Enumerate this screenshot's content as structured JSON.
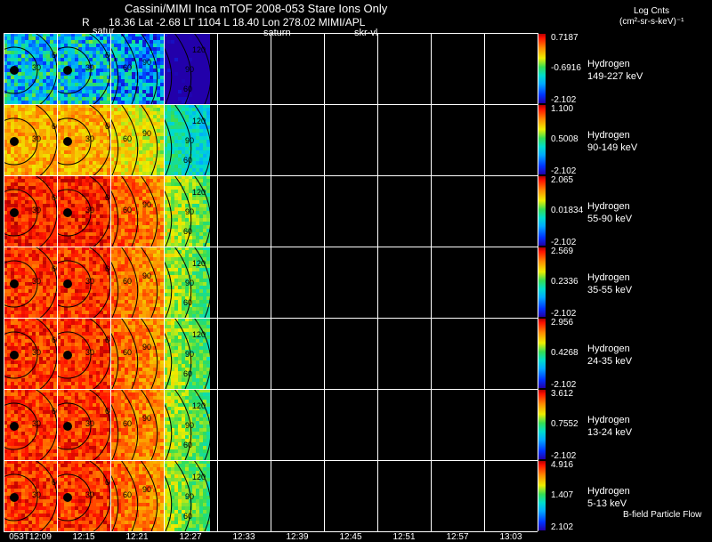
{
  "header": {
    "title": "Cassini/MIMI Inca mTOF  2008-053   Stare   Ions Only",
    "r_label": "R",
    "position_line": "18.36 Lat -2.68 LT 1104 L       18.40 Lon       278.02  MIMI/APL",
    "overlay_1": "satur",
    "overlay_2": "saturn",
    "overlay_3": "skr-vl",
    "units_title": "Log Cnts",
    "units_sub": "(cm²-sr-s-keV)⁻¹"
  },
  "panels": [
    {
      "species": "Hydrogen",
      "energy": "149-227 keV",
      "cb_max": "0.7187",
      "cb_mid": "-0.6916",
      "cb_min": "-2.102",
      "intensity": 0.35
    },
    {
      "species": "Hydrogen",
      "energy": "90-149 keV",
      "cb_max": "1.100",
      "cb_mid": "0.5008",
      "cb_min": "-2.102",
      "intensity": 0.75
    },
    {
      "species": "Hydrogen",
      "energy": "55-90 keV",
      "cb_max": "2.065",
      "cb_mid": "0.01834",
      "cb_min": "-2.102",
      "intensity": 0.92
    },
    {
      "species": "Hydrogen",
      "energy": "35-55 keV",
      "cb_max": "2.569",
      "cb_mid": "0.2336",
      "cb_min": "-2.102",
      "intensity": 0.9
    },
    {
      "species": "Hydrogen",
      "energy": "24-35 keV",
      "cb_max": "2.956",
      "cb_mid": "0.4268",
      "cb_min": "-2.102",
      "intensity": 0.9
    },
    {
      "species": "Hydrogen",
      "energy": "13-24 keV",
      "cb_max": "3.612",
      "cb_mid": "0.7552",
      "cb_min": "-2.102",
      "intensity": 0.9
    },
    {
      "species": "Hydrogen",
      "energy": "5-13 keV",
      "cb_max": "4.916",
      "cb_mid": "1.407",
      "cb_min": "2.102",
      "intensity": 0.9
    }
  ],
  "footer_note": "B-field Particle Flow",
  "time_labels": [
    "053T12:09",
    "12:15",
    "12:21",
    "12:27",
    "12:33",
    "12:39",
    "12:45",
    "12:51",
    "12:57",
    "13:03"
  ],
  "contour_labels": [
    "30",
    "60",
    "90",
    "120"
  ],
  "colors": {
    "background": "#000000",
    "grid_line": "#ffffff"
  }
}
